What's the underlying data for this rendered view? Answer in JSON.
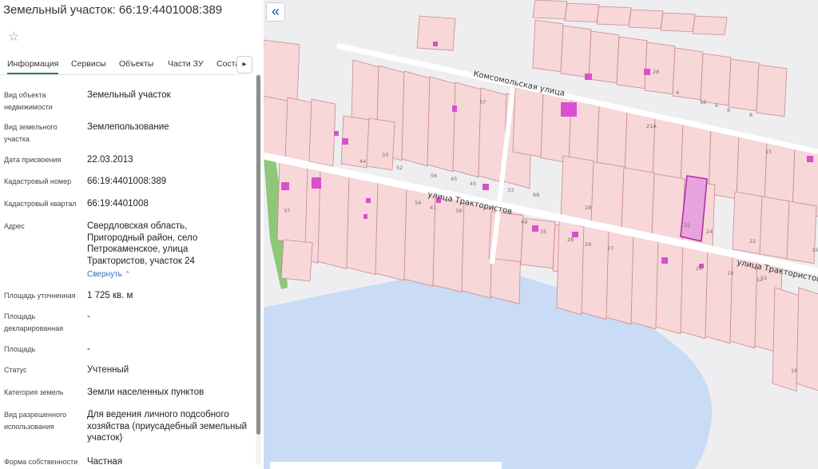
{
  "header": {
    "title": "Земельный участок: 66:19:4401008:389"
  },
  "tabs": [
    {
      "label": "Информация",
      "active": true
    },
    {
      "label": "Сервисы"
    },
    {
      "label": "Объекты"
    },
    {
      "label": "Части ЗУ"
    },
    {
      "label": "Соста"
    }
  ],
  "info": {
    "object_type_label": "Вид объекта недвижимости",
    "object_type_value": "Земельный участок",
    "land_type_label": "Вид земельного участка",
    "land_type_value": "Землепользование",
    "assigned_label": "Дата присвоения",
    "assigned_value": "22.03.2013",
    "cad_number_label": "Кадастровый номер",
    "cad_number_value": "66:19:4401008:389",
    "cad_quarter_label": "Кадастровый квартал",
    "cad_quarter_value": "66:19:4401008",
    "address_label": "Адрес",
    "address_line1": "Свердловская область,",
    "address_line2": "Пригородный район, село",
    "address_line3": "Петрокаменское, улица",
    "address_line4": "Трактористов, участок 24",
    "collapse_label": "Свернуть",
    "area_refined_label": "Площадь уточненная",
    "area_refined_value": "1 725 кв. м",
    "area_declared_label": "Площадь декларированная",
    "area_declared_value": "-",
    "area_label": "Площадь",
    "area_value": "-",
    "status_label": "Статус",
    "status_value": "Учтенный",
    "category_label": "Категория земель",
    "category_value": "Земли населенных пунктов",
    "permitted_use_label": "Вид разрешенного использования",
    "permitted_use_line1": "Для ведения личного подсобного",
    "permitted_use_line2": "хозяйства (приусадебный земельный",
    "permitted_use_line3": "участок)",
    "ownership_label": "Форма собственности",
    "ownership_value": "Частная"
  },
  "map": {
    "street_komsomolskaya": "Комсомольская улица",
    "street_traktoristov_1": "улица Трактористов",
    "street_traktoristov_2": "улица Трактористов",
    "plot_numbers": [
      "37",
      "33",
      "52",
      "56",
      "45",
      "45",
      "44",
      "54",
      "41",
      "39",
      "37",
      "49",
      "35",
      "33",
      "68",
      "18",
      "32",
      "24",
      "22",
      "28",
      "29",
      "27",
      "25",
      "19",
      "15",
      "15б",
      "18",
      "6",
      "4",
      "28",
      "15",
      "21А",
      "8",
      "8",
      "18",
      "12"
    ],
    "colors": {
      "parcel_fill": "#f7d7d8",
      "parcel_stroke": "#c98a8e",
      "building": "#d94fcf",
      "water": "#c9dbf5",
      "selected": "#b12fa5",
      "green": "#8cc77a"
    }
  }
}
